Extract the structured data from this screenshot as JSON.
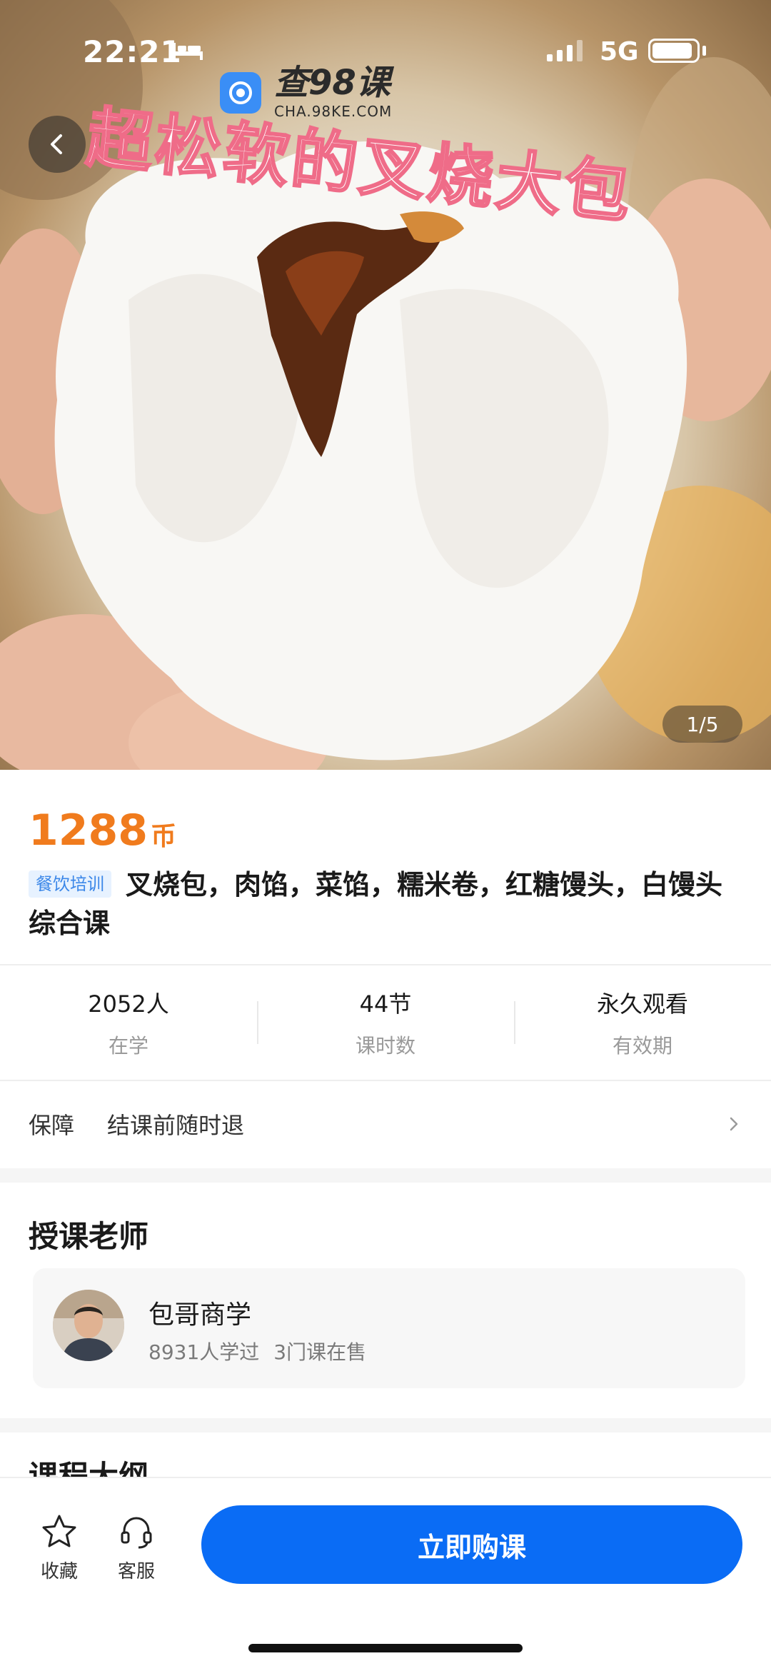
{
  "status_bar": {
    "time": "22:21",
    "network": "5G"
  },
  "watermark": {
    "title": "查98课",
    "url": "CHA.98KE.COM"
  },
  "hero": {
    "title": "超松软的叉烧大包",
    "page_counter": "1/5"
  },
  "course": {
    "price": "1288",
    "price_unit": "币",
    "category": "餐饮培训",
    "title": "叉烧包，肉馅，菜馅，糯米卷，红糖馒头，白馒头综合课"
  },
  "stats": [
    {
      "value": "2052人",
      "label": "在学"
    },
    {
      "value": "44节",
      "label": "课时数"
    },
    {
      "value": "永久观看",
      "label": "有效期"
    }
  ],
  "guarantee": {
    "label": "保障",
    "text": "结课前随时退"
  },
  "teacher_section": {
    "title": "授课老师",
    "name": "包哥商学",
    "learners": "8931人学过",
    "courses": "3门课在售"
  },
  "outline_section": {
    "title": "课程大纲"
  },
  "bottom_bar": {
    "favorite": "收藏",
    "service": "客服",
    "buy": "立即购课"
  },
  "colors": {
    "price": "#f07b1d",
    "primary": "#0a6cf5",
    "badge_bg": "#e7f2ff",
    "badge_text": "#3b87e8"
  }
}
